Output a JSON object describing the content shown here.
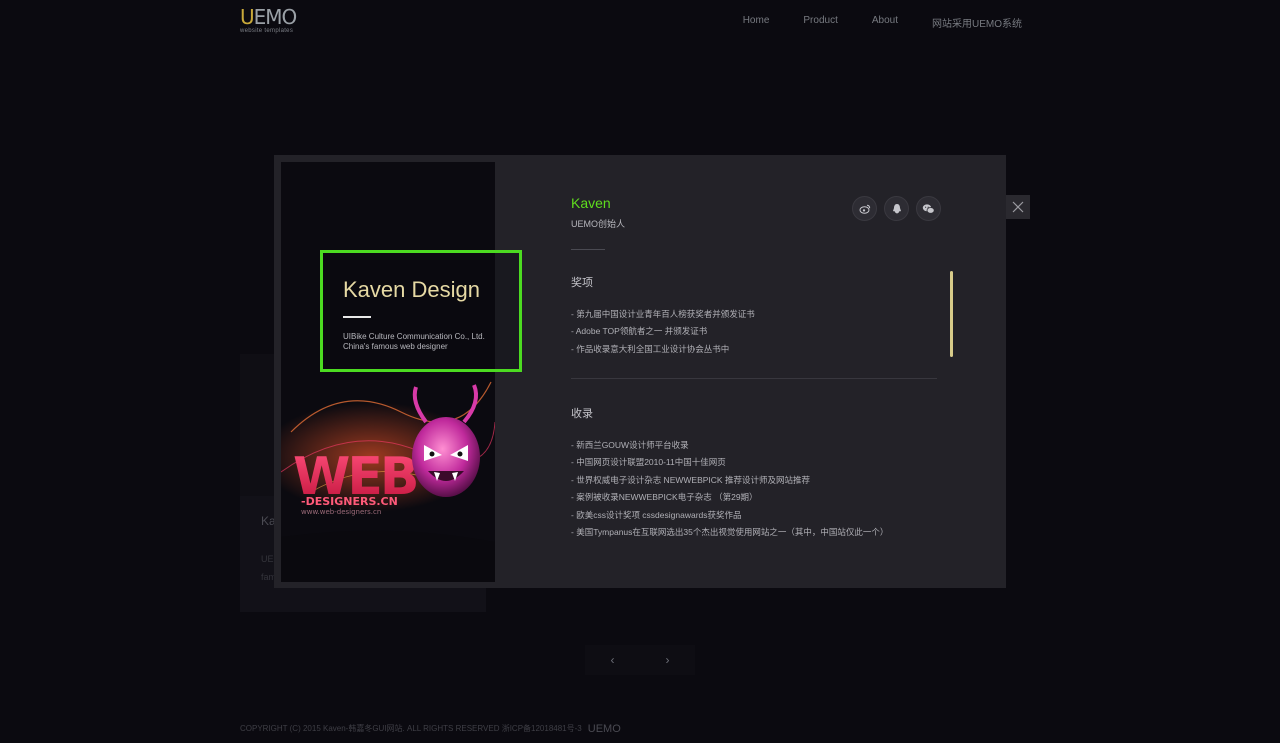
{
  "header": {
    "logo_main_u": "U",
    "logo_main_rest": "EMO",
    "logo_sub": "website templates",
    "nav": [
      {
        "label": "Home"
      },
      {
        "label": "Product"
      },
      {
        "label": "About"
      },
      {
        "label": "网站采用UEMO系统"
      }
    ]
  },
  "background": {
    "card_title": "Ka",
    "card_line1": "UE",
    "card_line2": "fam",
    "pager_prev": "‹",
    "pager_next": "›"
  },
  "footer": {
    "text": "COPYRIGHT (C) 2015 Kaven-韩嘉冬GUI网站. ALL RIGHTS RESERVED 浙ICP备12018481号-3",
    "logo": "UEMO"
  },
  "modal": {
    "design": {
      "title": "Kaven Design",
      "line1": "UIBike Culture Communication Co., Ltd.",
      "line2": "China's famous web designer"
    },
    "artwork_text": {
      "big": "WEB",
      "small": "-DESIGNERS.CN",
      "url": "www.web-designers.cn"
    },
    "profile": {
      "name": "Kaven",
      "role": "UEMO创始人"
    },
    "social": [
      {
        "name": "weibo-icon"
      },
      {
        "name": "qq-icon"
      },
      {
        "name": "wechat-icon"
      }
    ],
    "awards": {
      "title": "奖项",
      "items": [
        "- 第九届中国设计业青年百人榜获奖者并颁发证书",
        "-  Adobe TOP领航者之一  并颁发证书",
        "-  作品收录意大利全国工业设计协会丛书中"
      ]
    },
    "collections": {
      "title": "收录",
      "items": [
        "-  新西兰GOUW设计师平台收录",
        "-  中国网页设计联盟2010-11中国十佳网页",
        "-  世界权威电子设计杂志 NEWWEBPICK 推荐设计师及网站推荐",
        "-  案例被收录NEWWEBPICK电子杂志 （第29期）",
        "-  欧美css设计奖项 cssdesignawards获奖作品",
        "-  美国Tympanus在互联网选出35个杰出视觉使用网站之一（其中，中国站仅此一个）"
      ]
    }
  }
}
